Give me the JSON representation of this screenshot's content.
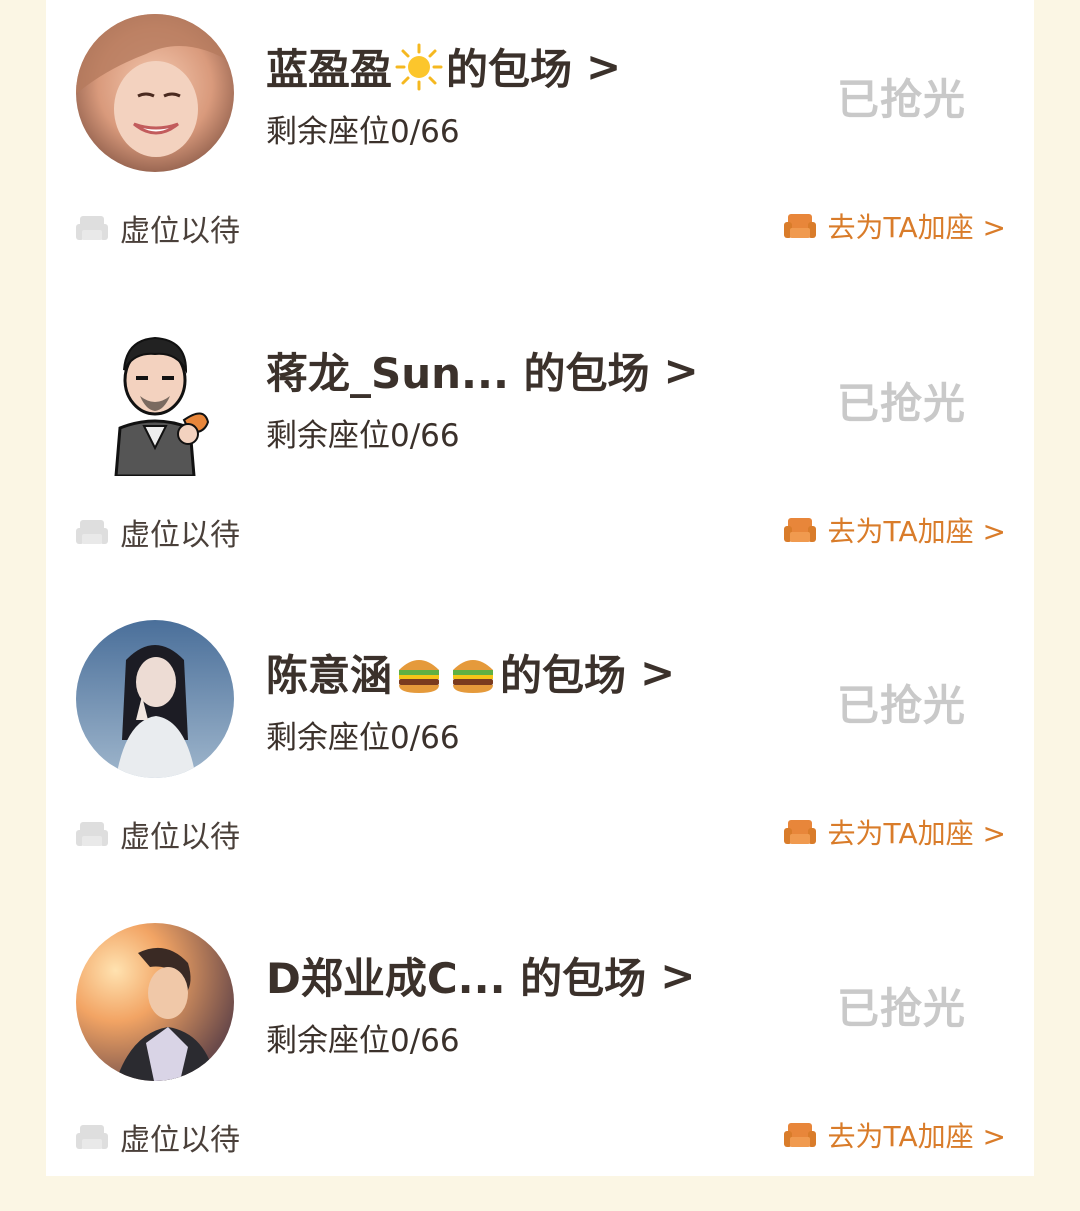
{
  "colors": {
    "background": "#fbf6e4",
    "card": "#ffffff",
    "soldout": "#c9c9c9",
    "accent": "#d97c2a",
    "sofa_gray": "#dedede"
  },
  "cards": [
    {
      "name_prefix": "蓝盈盈",
      "emoji": "sun-emoji-icon",
      "name_suffix": "的包场",
      "arrow": ">",
      "seats": "剩余座位0/66",
      "status": "已抢光",
      "waiting": "虚位以待",
      "add_seat": "去为TA加座 >"
    },
    {
      "name_prefix": "蒋龙_Sun... 的包场",
      "emoji": "",
      "name_suffix": "",
      "arrow": ">",
      "seats": "剩余座位0/66",
      "status": "已抢光",
      "waiting": "虚位以待",
      "add_seat": "去为TA加座 >"
    },
    {
      "name_prefix": "陈意涵",
      "emoji": "burger-emoji-icon",
      "name_suffix": "的包场",
      "arrow": ">",
      "seats": "剩余座位0/66",
      "status": "已抢光",
      "waiting": "虚位以待",
      "add_seat": "去为TA加座 >"
    },
    {
      "name_prefix": "D郑业成C... 的包场",
      "emoji": "",
      "name_suffix": "",
      "arrow": ">",
      "seats": "剩余座位0/66",
      "status": "已抢光",
      "waiting": "虚位以待",
      "add_seat": "去为TA加座 >"
    }
  ]
}
